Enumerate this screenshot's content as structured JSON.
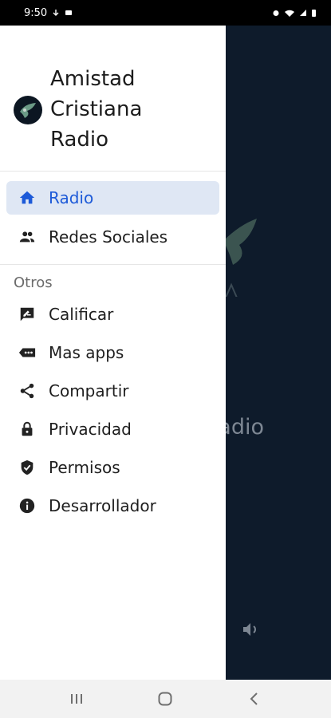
{
  "status_bar": {
    "time": "9:50"
  },
  "background": {
    "title_fragment": "a Radio"
  },
  "drawer": {
    "title": "Amistad Cristiana Radio",
    "main_items": [
      {
        "label": "Radio",
        "icon": "home-icon",
        "selected": true
      },
      {
        "label": "Redes Sociales",
        "icon": "people-icon",
        "selected": false
      }
    ],
    "section_title": "Otros",
    "other_items": [
      {
        "label": "Calificar",
        "icon": "rate-review-icon"
      },
      {
        "label": "Mas apps",
        "icon": "more-apps-icon"
      },
      {
        "label": "Compartir",
        "icon": "share-icon"
      },
      {
        "label": "Privacidad",
        "icon": "lock-icon"
      },
      {
        "label": "Permisos",
        "icon": "shield-check-icon"
      },
      {
        "label": "Desarrollador",
        "icon": "info-icon"
      }
    ]
  },
  "colors": {
    "accent": "#1d5ad8",
    "selected_bg": "#dfe7f4",
    "app_bg": "#0e1b2b"
  }
}
